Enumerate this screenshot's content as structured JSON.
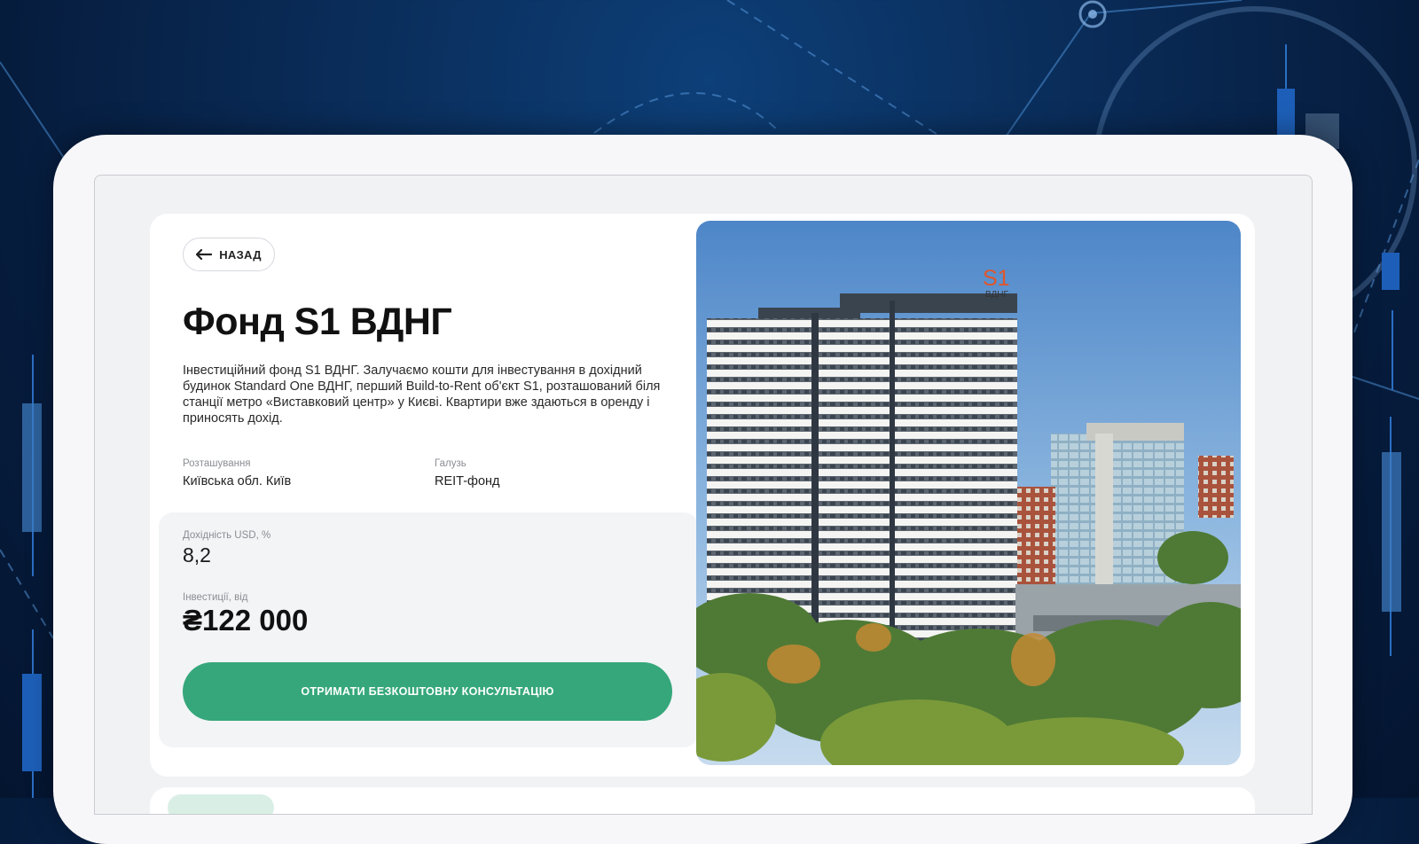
{
  "back_button": {
    "label": "НАЗАД"
  },
  "fund": {
    "title": "Фонд S1 ВДНГ",
    "description": "Інвестиційний фонд S1 ВДНГ. Залучаємо кошти для інвестування в дохідний будинок Standard One ВДНГ, перший Build-to-Rent об'єкт S1, розташований біля станції метро «Виставковий центр» у Києві. Квартири вже здаються в оренду і приносять дохід."
  },
  "meta": {
    "location_label": "Розташування",
    "location_value": "Київська обл. Київ",
    "industry_label": "Галузь",
    "industry_value": "REIT-фонд"
  },
  "stats": {
    "yield_label": "Дохідність USD, %",
    "yield_value": "8,2",
    "investment_label": "Інвестиції, від",
    "investment_value": "₴122 000"
  },
  "cta": {
    "label": "ОТРИМАТИ БЕЗКОШТОВНУ КОНСУЛЬТАЦІЮ"
  },
  "photo": {
    "logo_main": "S1",
    "logo_sub": "ВДНГ"
  },
  "colors": {
    "accent_green": "#35a77b",
    "background_navy": "#0a2d5a",
    "logo_orange": "#e0562a"
  },
  "icons": {
    "back": "arrow-left-icon"
  }
}
